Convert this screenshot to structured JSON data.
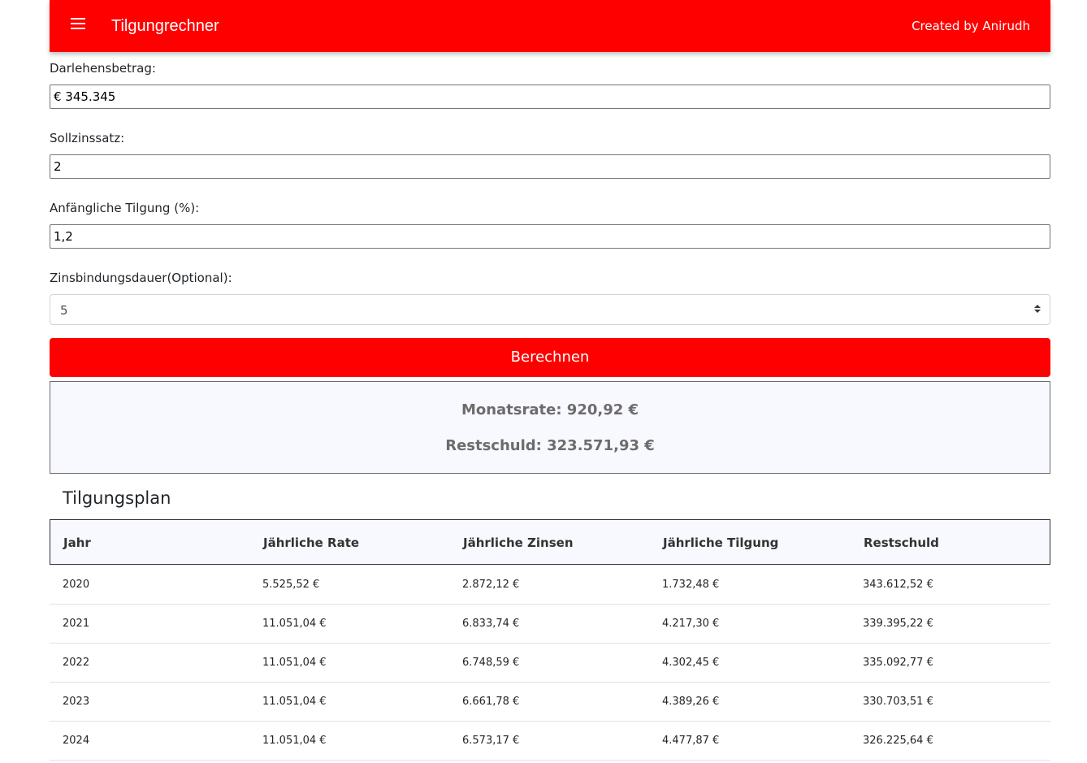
{
  "appbar": {
    "title": "Tilgungrechner",
    "created_by": "Created by Anirudh",
    "menu_icon": "hamburger-menu-icon",
    "color": "#ff0000"
  },
  "form": {
    "loan_label": "Darlehensbetrag:",
    "loan_value": "€ 345.345",
    "rate_label": "Sollzinssatz:",
    "rate_value": "2",
    "repayment_label": "Anfängliche Tilgung (%):",
    "repayment_value": "1,2",
    "fixed_period_label": "Zinsbindungsdauer(Optional):",
    "fixed_period_value": "5",
    "calculate_label": "Berechnen"
  },
  "results": {
    "monthly_rate": "Monatsrate: 920,92 €",
    "remaining_debt": "Restschuld: 323.571,93 €"
  },
  "schedule": {
    "title": "Tilgungsplan",
    "columns": [
      "Jahr",
      "Jährliche Rate",
      "Jährliche Zinsen",
      "Jährliche Tilgung",
      "Restschuld"
    ],
    "rows": [
      [
        "2020",
        "5.525,52 €",
        "2.872,12 €",
        "1.732,48 €",
        "343.612,52 €"
      ],
      [
        "2021",
        "11.051,04 €",
        "6.833,74 €",
        "4.217,30 €",
        "339.395,22 €"
      ],
      [
        "2022",
        "11.051,04 €",
        "6.748,59 €",
        "4.302,45 €",
        "335.092,77 €"
      ],
      [
        "2023",
        "11.051,04 €",
        "6.661,78 €",
        "4.389,26 €",
        "330.703,51 €"
      ],
      [
        "2024",
        "11.051,04 €",
        "6.573,17 €",
        "4.477,87 €",
        "326.225,64 €"
      ]
    ]
  }
}
